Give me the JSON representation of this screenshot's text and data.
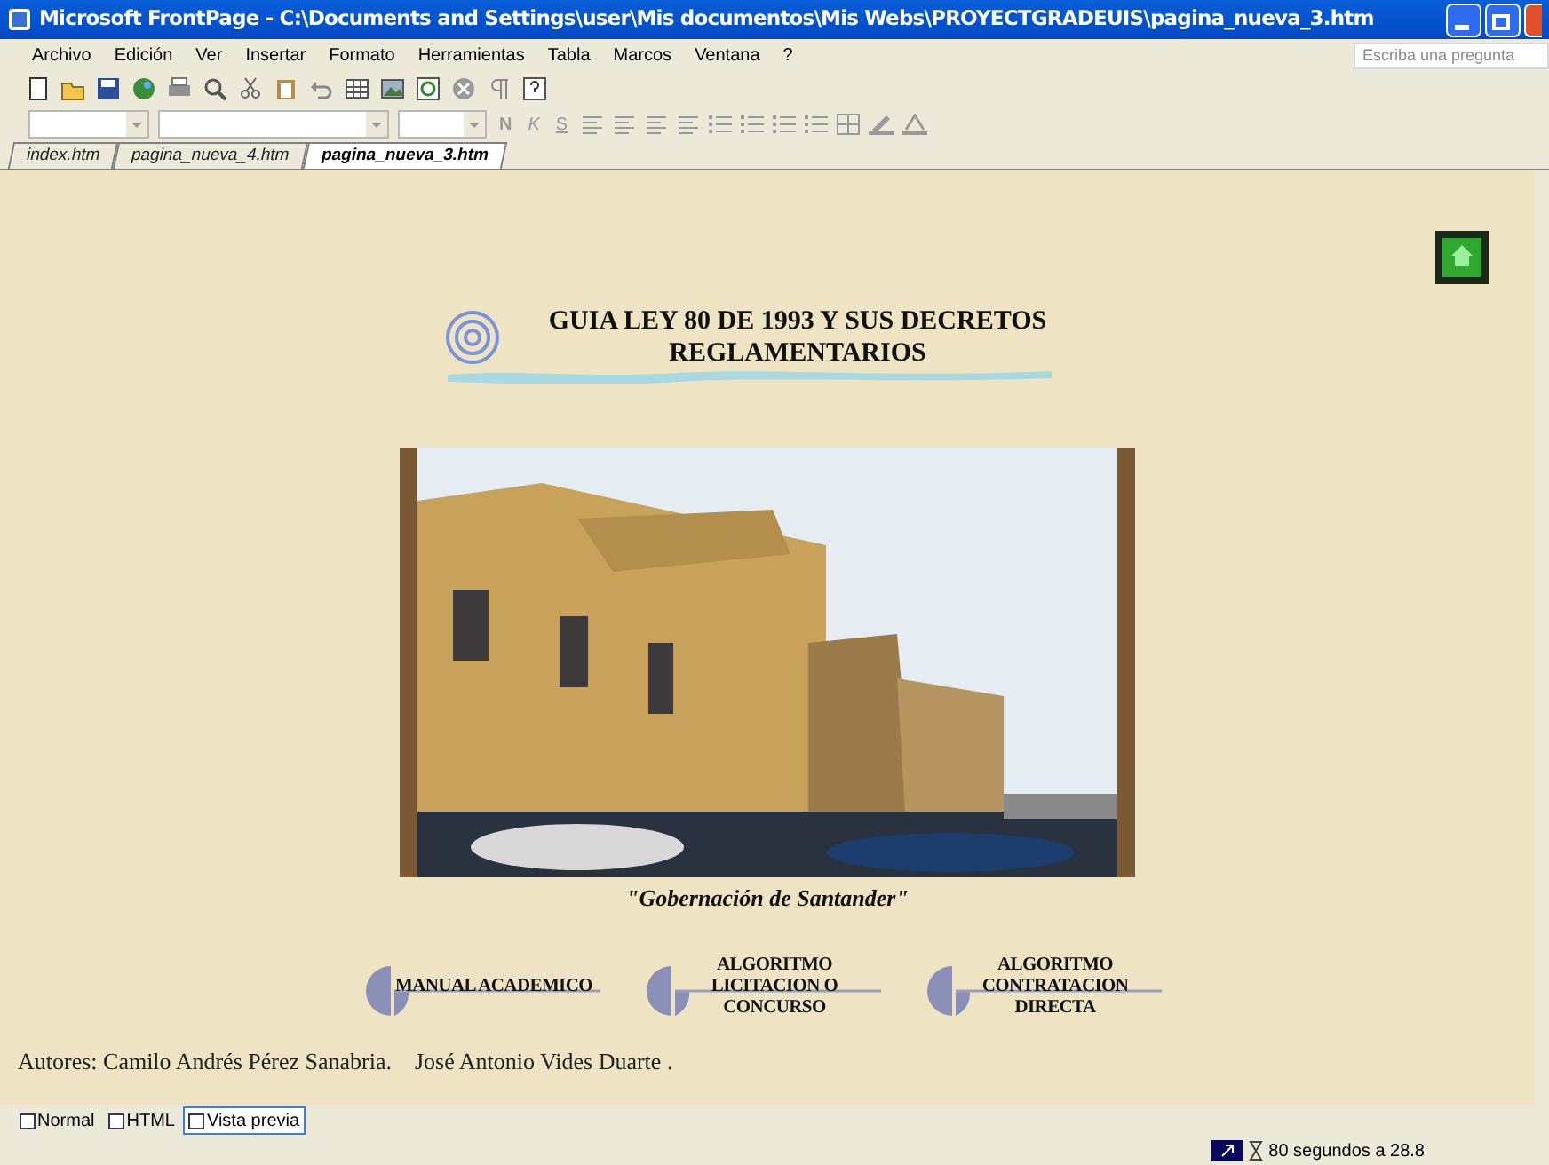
{
  "window": {
    "title": "Microsoft FrontPage - C:\\Documents and Settings\\user\\Mis documentos\\Mis Webs\\PROYECTGRADEUIS\\pagina_nueva_3.htm"
  },
  "menu": [
    "Archivo",
    "Edición",
    "Ver",
    "Insertar",
    "Formato",
    "Herramientas",
    "Tabla",
    "Marcos",
    "Ventana",
    "?"
  ],
  "help_search": {
    "placeholder": "Escriba una pregunta"
  },
  "format_toolbar": {
    "bold": "N",
    "italic": "K",
    "underline": "S"
  },
  "tabs": [
    {
      "label": "index.htm",
      "selected": false
    },
    {
      "label": "pagina_nueva_4.htm",
      "selected": false
    },
    {
      "label": "pagina_nueva_3.htm",
      "selected": true
    }
  ],
  "page": {
    "heading": "GUIA LEY 80 DE 1993 Y SUS DECRETOS REGLAMENTARIOS",
    "caption": "\"Gobernación de Santander\"",
    "nav_buttons": [
      "MANUAL ACADEMICO",
      "ALGORITMO LICITACION O CONCURSO",
      "ALGORITMO CONTRATACION DIRECTA"
    ],
    "authors": "Autores: Camilo Andrés Pérez Sanabria.    José Antonio Vides Duarte ."
  },
  "view_tabs": [
    {
      "label": "Normal",
      "selected": false
    },
    {
      "label": "HTML",
      "selected": false
    },
    {
      "label": "Vista previa",
      "selected": true
    }
  ],
  "status_bar": {
    "download_time": "80 segundos a 28.8"
  }
}
